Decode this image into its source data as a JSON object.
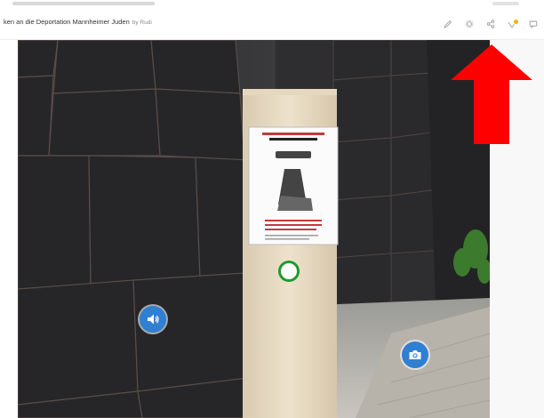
{
  "header": {
    "title": "ken an die Deportation Mannheimer Juden",
    "byline": "by Rudi"
  },
  "toolbar": {
    "items": [
      "pencil-icon",
      "settings-icon",
      "share-icon",
      "ar-view-icon",
      "comment-icon"
    ],
    "badge_color": "#f0b400"
  },
  "hotspots": {
    "audio": "speaker-icon",
    "camera": "camera-icon",
    "info": "info-circle",
    "accent_color": "#2f7fd3",
    "info_color": "#1e9b2e"
  },
  "annotation": {
    "arrow_color": "#ff0000",
    "points_to": "share-icon"
  }
}
